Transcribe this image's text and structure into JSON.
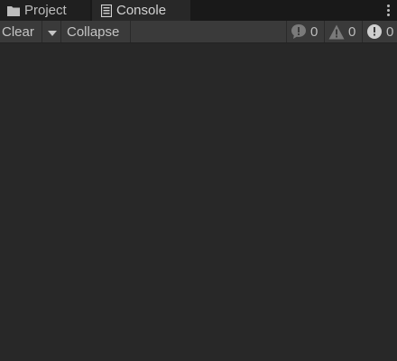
{
  "tabs": {
    "project_label": "Project",
    "console_label": "Console"
  },
  "toolbar": {
    "clear_label": "Clear",
    "collapse_label": "Collapse",
    "message_count": "0",
    "warning_count": "0",
    "error_count": "0"
  },
  "icons": {
    "project": "folder-icon",
    "console": "console-icon",
    "menu": "more-vertical-icon",
    "dropdown": "caret-down-icon",
    "message": "info-bubble-icon",
    "warning": "warning-triangle-icon",
    "error": "error-circle-icon"
  },
  "colors": {
    "background": "#282828",
    "tab_bar": "#191919",
    "toolbar": "#3a3a3a",
    "text": "#c4c4c4"
  }
}
